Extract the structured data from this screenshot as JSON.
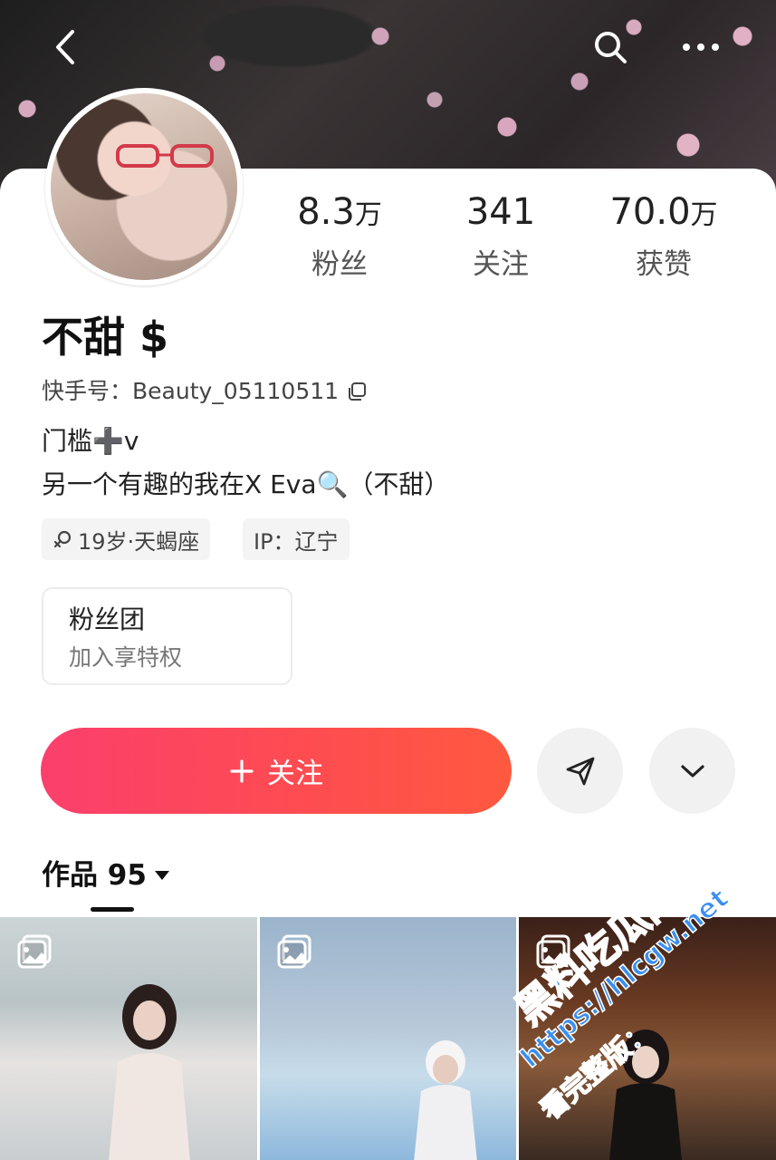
{
  "header": {
    "back_icon": "chevron-left-icon",
    "search_icon": "search-icon",
    "more_icon": "more-dots-icon"
  },
  "profile": {
    "name": "不甜 $",
    "uid": "快手号：Beauty_05110511",
    "bio": [
      "门槛➕v",
      "另一个有趣的我在X Eva🔍（不甜）"
    ],
    "tags": {
      "age": "19岁·天蝎座",
      "ip": "IP：辽宁"
    }
  },
  "stats": {
    "fans": {
      "value": "8.3",
      "unit": "万",
      "label": "粉丝"
    },
    "following": {
      "value": "341",
      "unit": "",
      "label": "关注"
    },
    "likes": {
      "value": "70.0",
      "unit": "万",
      "label": "获赞"
    }
  },
  "fan_group": {
    "title": "粉丝团",
    "subtitle": "加入享特权"
  },
  "actions": {
    "follow_label": "关注",
    "follow_icon": "plus-icon",
    "share_icon": "share-icon",
    "dropdown_icon": "chevron-down-icon"
  },
  "works": {
    "label": "作品 95"
  },
  "watermark": {
    "main": "黑料吃瓜网",
    "url": "https://hlcgw.net",
    "sub": "看完整版："
  },
  "colors": {
    "follow_gradient_start": "#fb3f6c",
    "follow_gradient_end": "#ff5940",
    "watermark": "#3a8ff0"
  }
}
